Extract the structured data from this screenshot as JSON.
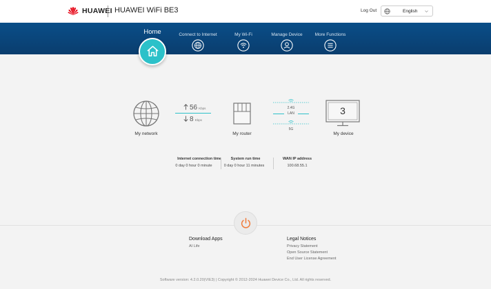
{
  "header": {
    "brand": "HUAWEI",
    "product": "HUAWEI WiFi BE3",
    "logout_label": "Log Out",
    "language": "English",
    "brand_color": "#e60012",
    "icons": {
      "language": "globe-icon",
      "dropdown": "chevron-down-icon"
    }
  },
  "nav": {
    "background": "#0a4e88",
    "accent": "#2cc1c9",
    "items": [
      {
        "label": "Home",
        "icon": "home-icon",
        "active": true
      },
      {
        "label": "Connect to Internet",
        "icon": "globe-icon"
      },
      {
        "label": "My Wi-Fi",
        "icon": "wifi-icon"
      },
      {
        "label": "Manage Device",
        "icon": "user-icon"
      },
      {
        "label": "More Functions",
        "icon": "menu-icon"
      }
    ]
  },
  "topology": {
    "network_label": "My network",
    "upload_speed": "56",
    "upload_unit": "Kbps",
    "download_speed": "8",
    "download_unit": "Kbps",
    "router_label": "My router",
    "band_24g": "2.4G",
    "band_lan": "LAN",
    "band_5g": "5G",
    "device_count": "3",
    "device_label": "My device"
  },
  "status": {
    "internet_time_label": "Internet connection time",
    "internet_time_value": "0 day 0 hour 0 minute",
    "run_time_label": "System run time",
    "run_time_value": "0 day 0 hour 11 minutes",
    "wan_ip_label": "WAN IP address",
    "wan_ip_value": "100.68.55.1"
  },
  "footer": {
    "power_icon": "power-icon",
    "power_color": "#f07c3c",
    "download_heading": "Download Apps",
    "download_links": [
      "AI Life"
    ],
    "legal_heading": "Legal Notices",
    "legal_links": [
      "Privacy Statement",
      "Open Source Statement",
      "End User License Agreement"
    ],
    "copyright": "Software version: 4.2.0.20(VIE3) | Copyright © 2012-2024 Huawei Device Co., Ltd. All rights reserved."
  }
}
